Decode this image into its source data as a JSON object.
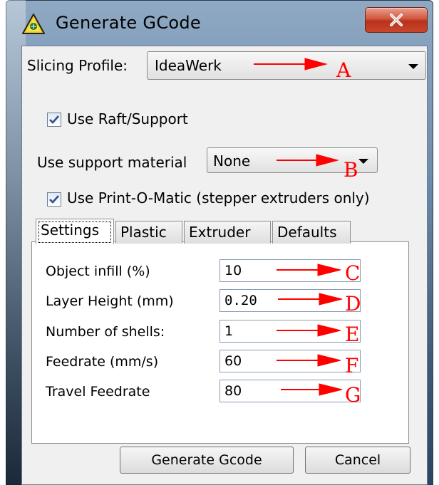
{
  "window": {
    "title": "Generate GCode",
    "icon": "warning-triangle-icon",
    "close_icon": "close-x-icon"
  },
  "slicing_profile": {
    "label": "Slicing Profile:",
    "value": "IdeaWerk"
  },
  "use_raft": {
    "label": "Use Raft/Support",
    "checked": true
  },
  "support_material": {
    "label": "Use support material",
    "value": "None"
  },
  "print_o_matic": {
    "label": "Use Print-O-Matic (stepper extruders only)",
    "checked": true
  },
  "tabs": [
    {
      "label": "Settings",
      "active": true
    },
    {
      "label": "Plastic",
      "active": false
    },
    {
      "label": "Extruder",
      "active": false
    },
    {
      "label": "Defaults",
      "active": false
    }
  ],
  "settings": [
    {
      "label": "Object infill (%)",
      "value": "10",
      "annotation": "C"
    },
    {
      "label": "Layer Height (mm)",
      "value": "0.20",
      "annotation": "D"
    },
    {
      "label": "Number of shells:",
      "value": "1",
      "annotation": "E"
    },
    {
      "label": "Feedrate (mm/s)",
      "value": "60",
      "annotation": "F"
    },
    {
      "label": "Travel Feedrate",
      "value": "80",
      "annotation": "G"
    }
  ],
  "annotations": {
    "profile": "A",
    "support": "B",
    "color": "#ff0000"
  },
  "buttons": {
    "generate": "Generate Gcode",
    "cancel": "Cancel"
  }
}
